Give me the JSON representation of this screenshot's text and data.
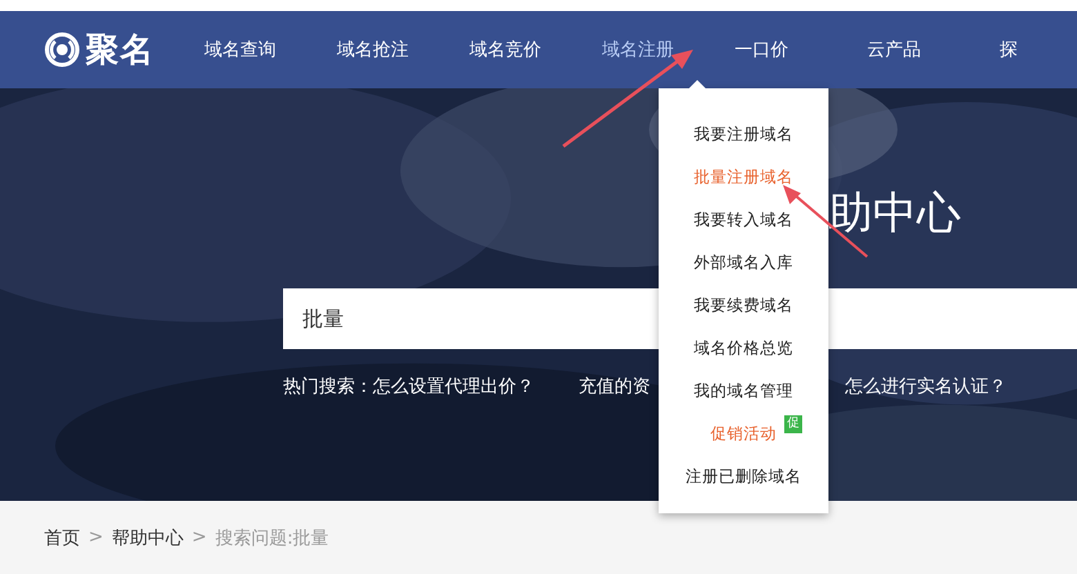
{
  "logo": {
    "text": "聚名"
  },
  "nav": [
    {
      "label": "域名查询",
      "selected": false
    },
    {
      "label": "域名抢注",
      "selected": false
    },
    {
      "label": "域名竞价",
      "selected": false
    },
    {
      "label": "域名注册",
      "selected": true
    },
    {
      "label": "一口价",
      "selected": false
    },
    {
      "label": "云产品",
      "selected": false
    },
    {
      "label": "探",
      "selected": false
    }
  ],
  "dropdown": [
    {
      "label": "我要注册域名",
      "highlighted": false
    },
    {
      "label": "批量注册域名",
      "highlighted": true
    },
    {
      "label": "我要转入域名",
      "highlighted": false
    },
    {
      "label": "外部域名入库",
      "highlighted": false
    },
    {
      "label": "我要续费域名",
      "highlighted": false
    },
    {
      "label": "域名价格总览",
      "highlighted": false
    },
    {
      "label": "我的域名管理",
      "highlighted": false
    },
    {
      "label": "促销活动",
      "highlighted": true,
      "badge": "促"
    },
    {
      "label": "注册已删除域名",
      "highlighted": false
    }
  ],
  "hero": {
    "kind": "picture",
    "title": "助中心",
    "search": {
      "value": "批量"
    },
    "hot_label": "热门搜索：",
    "hot": [
      "怎么设置代理出价？",
      "充值的资",
      "怎么进行实名认证？"
    ]
  },
  "breadcrumb": [
    {
      "label": "首页",
      "current": false
    },
    {
      "label": "帮助中心",
      "current": false
    },
    {
      "label": "搜索问题:批量",
      "current": true
    }
  ],
  "breadcrumb_separator": ">"
}
